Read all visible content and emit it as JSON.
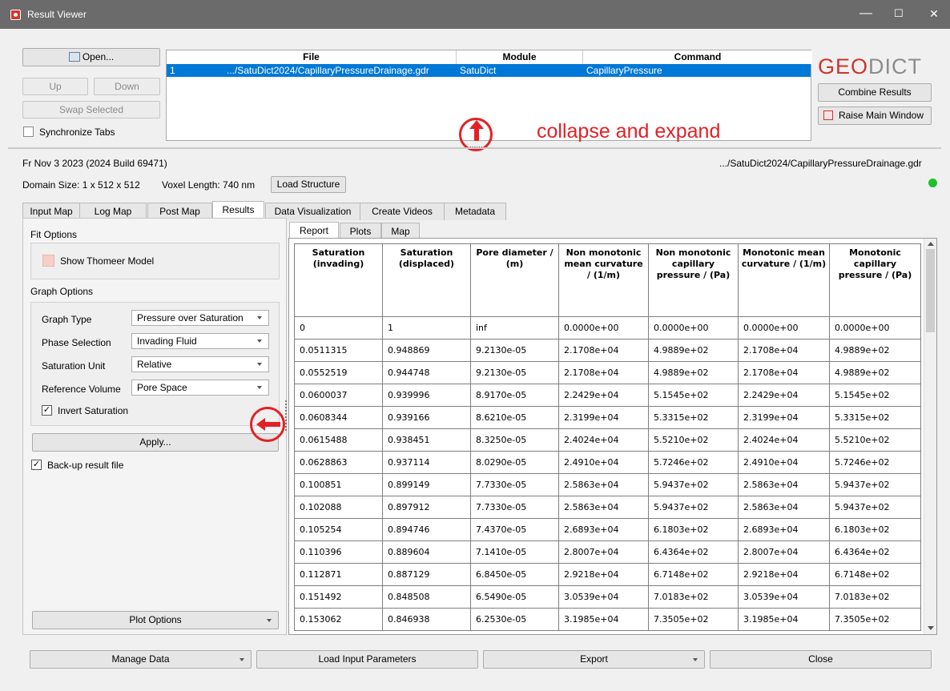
{
  "window": {
    "title": "Result Viewer",
    "minimize": "—",
    "maximize": "☐",
    "close": "✕"
  },
  "toolbar": {
    "open_label": "Open...",
    "up_label": "Up",
    "down_label": "Down",
    "swap_label": "Swap Selected",
    "sync_tabs_label": "Synchronize Tabs",
    "sync_tabs_checked": false
  },
  "file_list": {
    "headers": [
      "File",
      "Module",
      "Command"
    ],
    "rows": [
      {
        "index": "1",
        "file": ".../SatuDict2024/CapillaryPressureDrainage.gdr",
        "module": "SatuDict",
        "command": "CapillaryPressure"
      }
    ]
  },
  "logo": {
    "part1": "GEO",
    "part2": "DICT"
  },
  "right_buttons": {
    "combine_label": "Combine Results",
    "raise_label": "Raise Main Window"
  },
  "annotation": {
    "collapse_text": "collapse and expand",
    "splitter_dots": "......"
  },
  "info": {
    "date": "Fr Nov 3 2023 (2024 Build 69471)",
    "domain_size": "Domain Size: 1 x 512 x 512",
    "voxel_length": "Voxel Length: 740 nm",
    "load_structure_label": "Load Structure",
    "path": ".../SatuDict2024/CapillaryPressureDrainage.gdr",
    "status_color": "#1fc12a"
  },
  "main_tabs": [
    "Input Map",
    "Log Map",
    "Post Map",
    "Results",
    "Data Visualization",
    "Create Videos",
    "Metadata"
  ],
  "main_tab_active": "Results",
  "left_panel": {
    "fit_options_label": "Fit Options",
    "show_thomeer_label": "Show Thomeer Model",
    "graph_options_label": "Graph Options",
    "graph_type_label": "Graph Type",
    "graph_type_value": "Pressure over Saturation",
    "phase_selection_label": "Phase Selection",
    "phase_selection_value": "Invading Fluid",
    "saturation_unit_label": "Saturation Unit",
    "saturation_unit_value": "Relative",
    "reference_volume_label": "Reference Volume",
    "reference_volume_value": "Pore Space",
    "invert_saturation_label": "Invert Saturation",
    "invert_saturation_checked": true,
    "apply_label": "Apply...",
    "backup_label": "Back-up result file",
    "backup_checked": true,
    "plot_options_label": "Plot Options"
  },
  "sub_tabs": [
    "Report",
    "Plots",
    "Map"
  ],
  "sub_tab_active": "Report",
  "table": {
    "headers": [
      "Saturation (invading)",
      "Saturation (displaced)",
      "Pore diameter / (m)",
      "Non monotonic mean curvature / (1/m)",
      "Non monotonic capillary pressure / (Pa)",
      "Monotonic mean curvature / (1/m)",
      "Monotonic capillary pressure / (Pa)"
    ],
    "rows": [
      [
        "0",
        "1",
        "inf",
        "0.0000e+00",
        "0.0000e+00",
        "0.0000e+00",
        "0.0000e+00"
      ],
      [
        "0.0511315",
        "0.948869",
        "9.2130e-05",
        "2.1708e+04",
        "4.9889e+02",
        "2.1708e+04",
        "4.9889e+02"
      ],
      [
        "0.0552519",
        "0.944748",
        "9.2130e-05",
        "2.1708e+04",
        "4.9889e+02",
        "2.1708e+04",
        "4.9889e+02"
      ],
      [
        "0.0600037",
        "0.939996",
        "8.9170e-05",
        "2.2429e+04",
        "5.1545e+02",
        "2.2429e+04",
        "5.1545e+02"
      ],
      [
        "0.0608344",
        "0.939166",
        "8.6210e-05",
        "2.3199e+04",
        "5.3315e+02",
        "2.3199e+04",
        "5.3315e+02"
      ],
      [
        "0.0615488",
        "0.938451",
        "8.3250e-05",
        "2.4024e+04",
        "5.5210e+02",
        "2.4024e+04",
        "5.5210e+02"
      ],
      [
        "0.0628863",
        "0.937114",
        "8.0290e-05",
        "2.4910e+04",
        "5.7246e+02",
        "2.4910e+04",
        "5.7246e+02"
      ],
      [
        "0.100851",
        "0.899149",
        "7.7330e-05",
        "2.5863e+04",
        "5.9437e+02",
        "2.5863e+04",
        "5.9437e+02"
      ],
      [
        "0.102088",
        "0.897912",
        "7.7330e-05",
        "2.5863e+04",
        "5.9437e+02",
        "2.5863e+04",
        "5.9437e+02"
      ],
      [
        "0.105254",
        "0.894746",
        "7.4370e-05",
        "2.6893e+04",
        "6.1803e+02",
        "2.6893e+04",
        "6.1803e+02"
      ],
      [
        "0.110396",
        "0.889604",
        "7.1410e-05",
        "2.8007e+04",
        "6.4364e+02",
        "2.8007e+04",
        "6.4364e+02"
      ],
      [
        "0.112871",
        "0.887129",
        "6.8450e-05",
        "2.9218e+04",
        "6.7148e+02",
        "2.9218e+04",
        "6.7148e+02"
      ],
      [
        "0.151492",
        "0.848508",
        "6.5490e-05",
        "3.0539e+04",
        "7.0183e+02",
        "3.0539e+04",
        "7.0183e+02"
      ],
      [
        "0.153062",
        "0.846938",
        "6.2530e-05",
        "3.1985e+04",
        "7.3505e+02",
        "3.1985e+04",
        "7.3505e+02"
      ]
    ]
  },
  "bottom": {
    "manage_label": "Manage Data",
    "load_params_label": "Load Input Parameters",
    "export_label": "Export",
    "close_label": "Close"
  }
}
